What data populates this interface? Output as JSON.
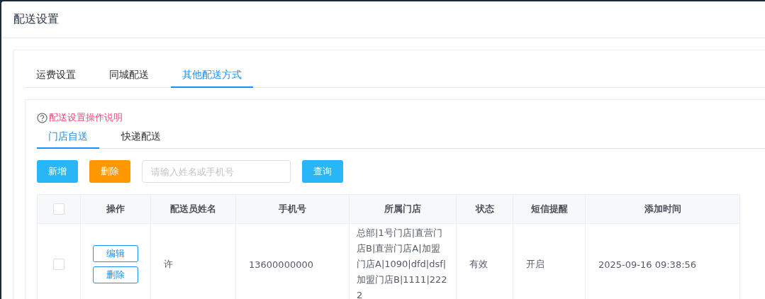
{
  "dialog": {
    "title": "配送设置"
  },
  "tabs": [
    {
      "label": "运费设置",
      "selected": false
    },
    {
      "label": "同城配送",
      "selected": false
    },
    {
      "label": "其他配送方式",
      "selected": true
    }
  ],
  "help_link": "配送设置操作说明",
  "sub_tabs": [
    {
      "label": "门店自送",
      "selected": true
    },
    {
      "label": "快递配送",
      "selected": false
    }
  ],
  "toolbar": {
    "add_button": "新增",
    "delete_button": "删除",
    "search": {
      "placeholder": "请输入姓名或手机号"
    },
    "query_button": "查询"
  },
  "table": {
    "select_all": {
      "checked": false
    },
    "columns": [
      "操作",
      "配送员姓名",
      "手机号",
      "所属门店",
      "状态",
      "短信提醒",
      "添加时间"
    ],
    "rows": [
      {
        "checked": false,
        "actions": [
          "编辑",
          "删除"
        ],
        "name": "许",
        "phone": "13600000000",
        "stores": "总部|1号门店|直营门店B|直营门店A|加盟门店A|1090|dfd|dsf|加盟门店B|1111|2222",
        "status": "有效",
        "sms": "开启",
        "added": "2025-09-16 09:38:56"
      }
    ]
  }
}
